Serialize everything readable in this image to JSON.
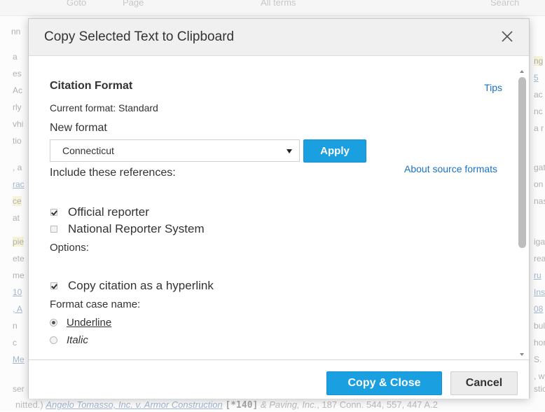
{
  "background": {
    "toolbar": [
      {
        "text": "Goto"
      },
      {
        "text": "Page"
      },
      {
        "text": "All terms"
      },
      {
        "text": "Search"
      }
    ],
    "bottom_line": {
      "prefix": "nitted.) ",
      "case_link": "Angelo Tomasso, Inc. v. Armor Construction",
      "star_page": "[*140]",
      "suffix_italic": " & Paving, Inc.",
      "suffix": ", 187 Conn. 544, 557, 447 A.2"
    }
  },
  "dialog": {
    "title": "Copy Selected Text to Clipboard",
    "close_icon": "close-icon",
    "citation_format": {
      "heading": "Citation Format",
      "tips_link": "Tips",
      "current_format": "Current format: Standard",
      "new_format_label": "New format",
      "selected_format": "Connecticut",
      "apply_label": "Apply",
      "about_link": "About source formats"
    },
    "references": {
      "label": "Include these references:",
      "items": [
        {
          "label": "Official reporter",
          "checked": true
        },
        {
          "label": "National Reporter System",
          "checked": false
        }
      ]
    },
    "options": {
      "label": "Options:",
      "items": [
        {
          "label": "Copy citation as a hyperlink",
          "checked": true
        }
      ]
    },
    "case_name": {
      "label": "Format case name:",
      "items": [
        {
          "label": "Underline",
          "selected": true
        },
        {
          "label": "Italic",
          "selected": false
        }
      ]
    },
    "footer": {
      "copy_close_label": "Copy & Close",
      "cancel_label": "Cancel"
    }
  },
  "colors": {
    "accent": "#1aa0e0",
    "link": "#1a73c6",
    "header_bg": "#f0f0f0"
  }
}
